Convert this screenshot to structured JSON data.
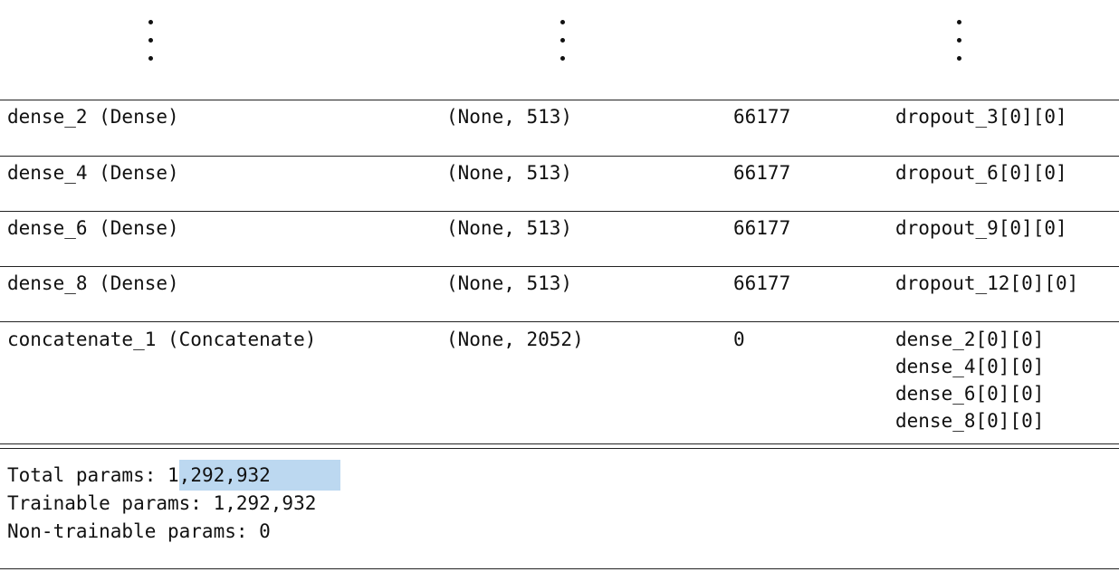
{
  "rows": [
    {
      "layer": "dense_2 (Dense)",
      "shape": "(None, 513)",
      "params": "66177",
      "connected": [
        "dropout_3[0][0]"
      ]
    },
    {
      "layer": "dense_4 (Dense)",
      "shape": "(None, 513)",
      "params": "66177",
      "connected": [
        "dropout_6[0][0]"
      ]
    },
    {
      "layer": "dense_6 (Dense)",
      "shape": "(None, 513)",
      "params": "66177",
      "connected": [
        "dropout_9[0][0]"
      ]
    },
    {
      "layer": "dense_8 (Dense)",
      "shape": "(None, 513)",
      "params": "66177",
      "connected": [
        "dropout_12[0][0]"
      ]
    },
    {
      "layer": "concatenate_1 (Concatenate)",
      "shape": "(None, 2052)",
      "params": "0",
      "connected": [
        "dense_2[0][0]",
        "dense_4[0][0]",
        "dense_6[0][0]",
        "dense_8[0][0]"
      ]
    }
  ],
  "summary": {
    "total_label": "Total params:",
    "total_value": "1,292,932",
    "trainable": "Trainable params: 1,292,932",
    "non_trainable": "Non-trainable params: 0"
  }
}
